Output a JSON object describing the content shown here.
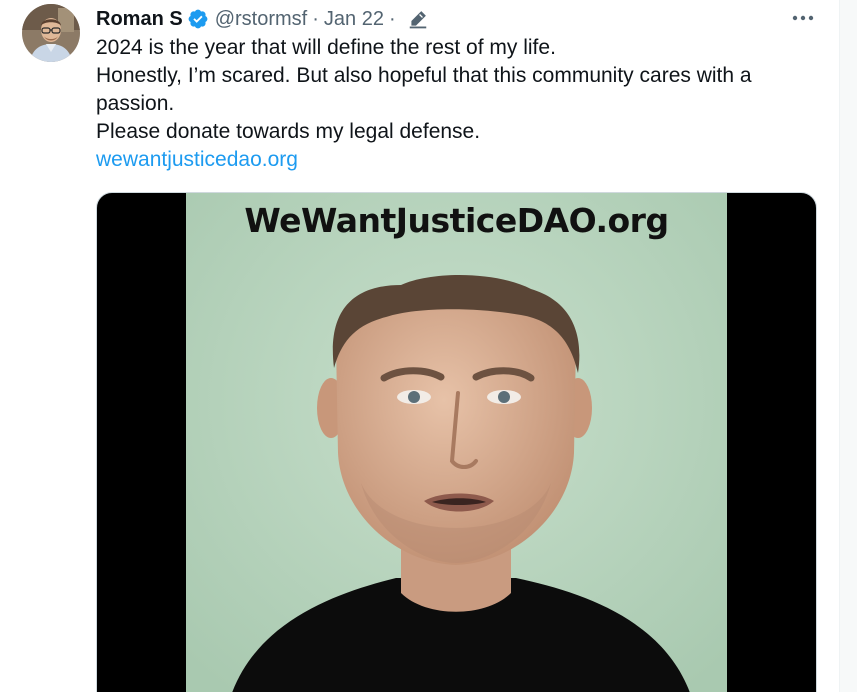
{
  "author": {
    "display_name": "Roman S",
    "handle": "@rstormsf",
    "separator": "·",
    "date": "Jan 22"
  },
  "icons": {
    "verified": "verified-badge-icon",
    "edit": "edited-pencil-icon",
    "more": "more-options-icon"
  },
  "tweet": {
    "lines": [
      "2024 is the year that will define the rest of my life.",
      "Honestly, I’m scared. But also hopeful that this community cares with a passion.",
      "Please donate towards my legal defense."
    ],
    "link": "wewantjusticedao.org"
  },
  "media": {
    "overlay_text": "WeWantJusticeDAO.org"
  },
  "colors": {
    "accent": "#1d9bf0",
    "text_primary": "#0f1419",
    "text_secondary": "#536471",
    "video_bg": "#bcd7c3"
  }
}
